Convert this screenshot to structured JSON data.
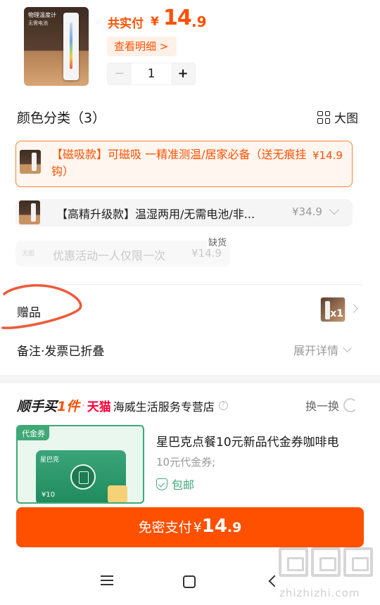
{
  "product": {
    "thumb_line1": "物理温度计",
    "thumb_line2": "无需电池",
    "paid_label": "共实付",
    "currency": "¥",
    "price_int": "14",
    "price_dec": ".9",
    "detail_button": "查看明细 >",
    "quantity": "1",
    "minus_glyph": "−",
    "plus_glyph": "+"
  },
  "sku": {
    "section_title": "颜色分类（3）",
    "big_image_label": "大图",
    "options": [
      {
        "label": "【磁吸款】可磁吸 一精准测温/居家必备（送无痕挂钩）",
        "price": "¥14.9",
        "state": "selected"
      },
      {
        "label": "【高精升级款】温湿两用/无需电池/非...",
        "price": "¥34.9",
        "state": "normal"
      },
      {
        "label": "优惠活动一人仅限一次",
        "price": "¥14.9",
        "state": "disabled",
        "no_image_text": "无图",
        "badge": "缺货"
      }
    ]
  },
  "gift": {
    "label": "赠品",
    "count_badge": "x1"
  },
  "remark": {
    "label": "备注·发票已折叠",
    "expand_label": "展开详情"
  },
  "promo": {
    "brand_prefix": "顺手买",
    "brand_highlight": "1件",
    "separator": "·",
    "tmall": "天猫",
    "store_name": "海威生活服务专营店",
    "info_glyph": "?",
    "swap_label": "换一换",
    "voucher_tag": "代金券",
    "voucher_brand": "星巴克",
    "voucher_amount": "¥10",
    "item_title": "星巴克点餐10元新品代金券咖啡电",
    "item_subtitle": "10元代金券;",
    "item_shipping": "包邮"
  },
  "pay": {
    "label": "免密支付",
    "currency": "¥",
    "price_int": "14",
    "price_dec": ".9"
  },
  "watermark": {
    "text": "zhizhizhi.com"
  },
  "colors": {
    "accent": "#ff5000",
    "voucher_green": "#3fa877",
    "tmall_red": "#ff0036"
  }
}
